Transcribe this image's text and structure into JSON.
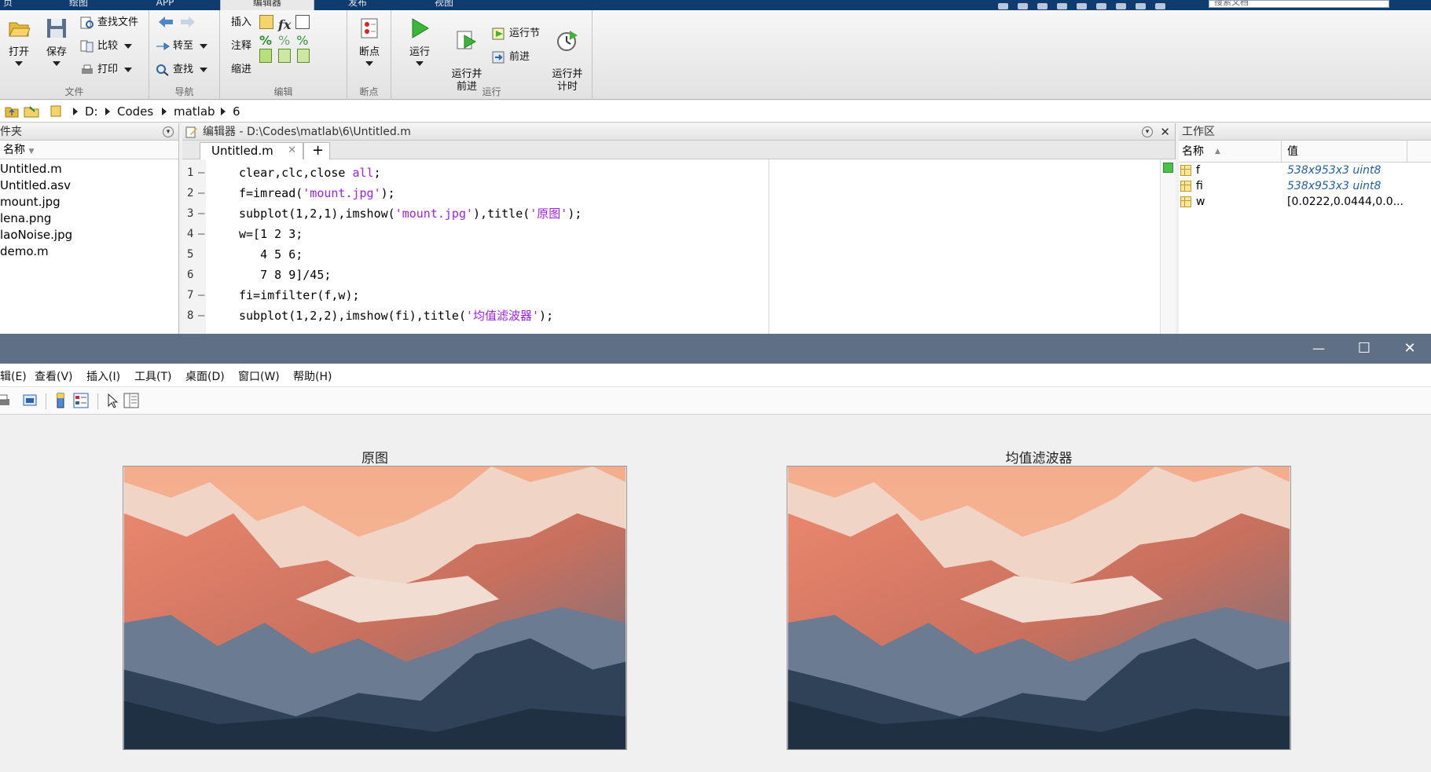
{
  "ribbon": {
    "tabs": [
      "页",
      "绘图",
      "APP",
      "编辑器",
      "发布",
      "视图"
    ],
    "search_placeholder": "搜索文档",
    "file_group": {
      "label": "文件",
      "open": "打开",
      "save": "保存",
      "find_files": "查找文件",
      "compare": "比较",
      "print": "打印"
    },
    "nav_group": {
      "label": "导航",
      "goto": "转至",
      "find": "查找"
    },
    "edit_group": {
      "label": "编辑",
      "insert": "插入",
      "comment": "注释",
      "indent": "缩进"
    },
    "breakpoint_group": {
      "label": "断点",
      "breakpoints": "断点"
    },
    "run_group": {
      "label": "运行",
      "run": "运行",
      "run_advance": "运行并\n前进",
      "run_section": "运行节",
      "advance": "前进",
      "run_time": "运行并\n计时"
    }
  },
  "path": {
    "segments": [
      "D:",
      "Codes",
      "matlab",
      "6"
    ]
  },
  "file_panel": {
    "title": "件夹",
    "col_name": "名称",
    "files": [
      "Untitled.m",
      "Untitled.asv",
      "mount.jpg",
      "lena.png",
      "laoNoise.jpg",
      "demo.m"
    ]
  },
  "editor": {
    "title": "编辑器 - D:\\Codes\\matlab\\6\\Untitled.m",
    "tab": "Untitled.m",
    "add_tab": "+",
    "line_numbers": [
      "1",
      "2",
      "3",
      "4",
      "5",
      "6",
      "7",
      "8"
    ],
    "markers": [
      "—",
      "—",
      "—",
      "—",
      "",
      "",
      "—",
      "—"
    ],
    "lines": [
      {
        "parts": [
          "clear,clc,close ",
          "all",
          ";"
        ]
      },
      {
        "parts": [
          "f=imread(",
          "'mount.jpg'",
          ");"
        ]
      },
      {
        "parts": [
          "subplot(1,2,1),imshow(",
          "'mount.jpg'",
          "),title(",
          "'原图'",
          ");"
        ]
      },
      {
        "parts": [
          "w=[1 2 3;"
        ]
      },
      {
        "parts": [
          "   4 5 6;"
        ]
      },
      {
        "parts": [
          "   7 8 9]/45;"
        ]
      },
      {
        "parts": [
          "fi=imfilter(f,w);"
        ]
      },
      {
        "parts": [
          "subplot(1,2,2),imshow(fi),title(",
          "'均值滤波器'",
          ");"
        ]
      }
    ]
  },
  "workspace": {
    "title": "工作区",
    "col_name": "名称",
    "col_value": "值",
    "vars": [
      {
        "name": "f",
        "value": "538x953x3 uint8"
      },
      {
        "name": "fi",
        "value": "538x953x3 uint8"
      },
      {
        "name": "w",
        "value": "[0.0222,0.0444,0.0..."
      }
    ]
  },
  "figure": {
    "window_controls": [
      "—",
      "☐",
      "✕"
    ],
    "menu": [
      "辑(E)",
      "查看(V)",
      "插入(I)",
      "工具(T)",
      "桌面(D)",
      "窗口(W)",
      "帮助(H)"
    ],
    "left_title": "原图",
    "right_title": "均值滤波器"
  },
  "colors": {
    "string": "#a020f0",
    "title_bar": "#5f6f85",
    "top_bar": "#0f3b6e",
    "var_value": "#1f5fa8"
  }
}
